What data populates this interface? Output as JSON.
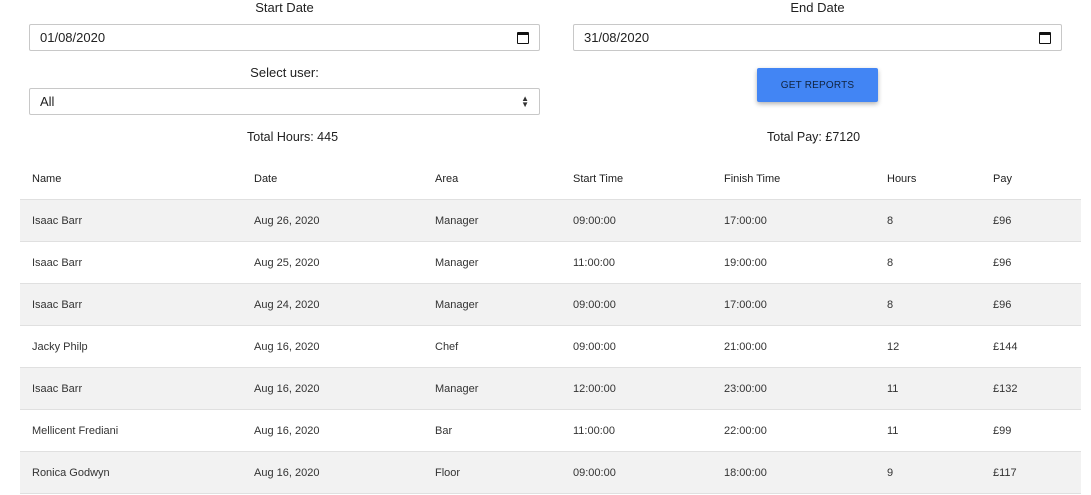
{
  "filters": {
    "start_date_label": "Start Date",
    "start_date_value": "01/08/2020",
    "end_date_label": "End Date",
    "end_date_value": "31/08/2020",
    "user_label": "Select user:",
    "user_value": "All",
    "get_reports_label": "GET REPORTS"
  },
  "totals": {
    "hours": "Total Hours: 445",
    "pay": "Total Pay: £7120"
  },
  "table": {
    "headers": [
      "Name",
      "Date",
      "Area",
      "Start Time",
      "Finish Time",
      "Hours",
      "Pay"
    ],
    "rows": [
      [
        "Isaac Barr",
        "Aug 26, 2020",
        "Manager",
        "09:00:00",
        "17:00:00",
        "8",
        "£96"
      ],
      [
        "Isaac Barr",
        "Aug 25, 2020",
        "Manager",
        "11:00:00",
        "19:00:00",
        "8",
        "£96"
      ],
      [
        "Isaac Barr",
        "Aug 24, 2020",
        "Manager",
        "09:00:00",
        "17:00:00",
        "8",
        "£96"
      ],
      [
        "Jacky Philp",
        "Aug 16, 2020",
        "Chef",
        "09:00:00",
        "21:00:00",
        "12",
        "£144"
      ],
      [
        "Isaac Barr",
        "Aug 16, 2020",
        "Manager",
        "12:00:00",
        "23:00:00",
        "11",
        "£132"
      ],
      [
        "Mellicent Frediani",
        "Aug 16, 2020",
        "Bar",
        "11:00:00",
        "22:00:00",
        "11",
        "£99"
      ],
      [
        "Ronica Godwyn",
        "Aug 16, 2020",
        "Floor",
        "09:00:00",
        "18:00:00",
        "9",
        "£117"
      ]
    ]
  },
  "colors": {
    "button_bg": "#4285f4",
    "row_stripe": "#f2f2f2"
  }
}
